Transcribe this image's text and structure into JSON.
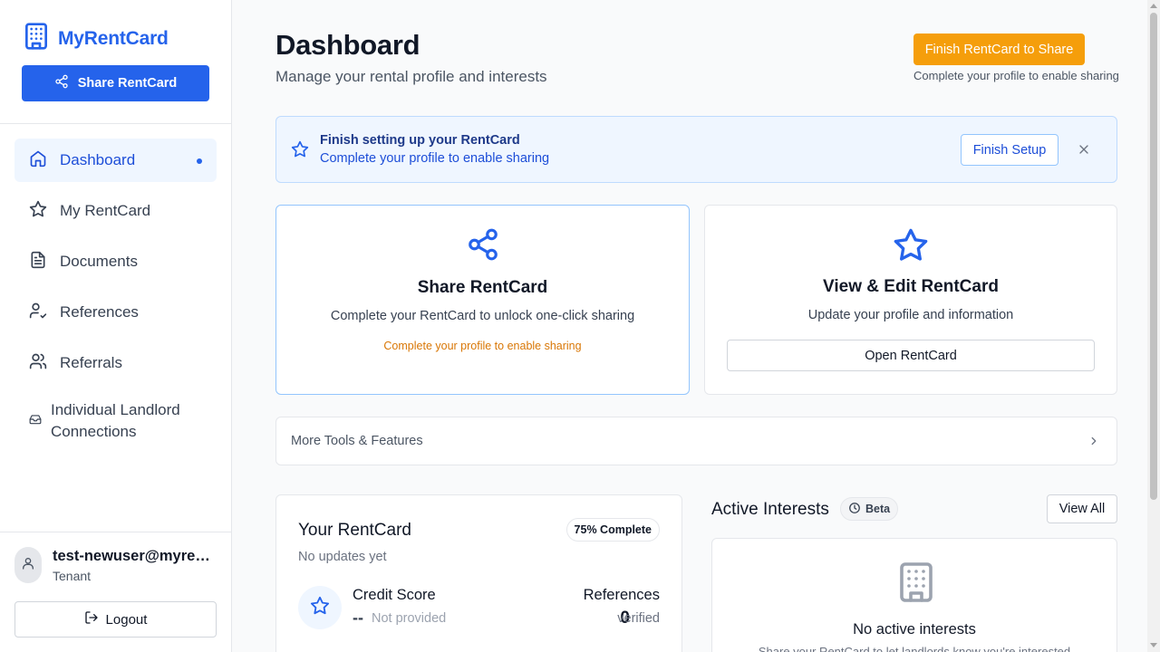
{
  "brand": {
    "name": "MyRentCard"
  },
  "sidebar": {
    "share_button": "Share RentCard",
    "items": [
      {
        "label": "Dashboard",
        "icon": "home-icon",
        "active": true
      },
      {
        "label": "My RentCard",
        "icon": "star-icon"
      },
      {
        "label": "Documents",
        "icon": "document-icon"
      },
      {
        "label": "References",
        "icon": "user-check-icon"
      },
      {
        "label": "Referrals",
        "icon": "users-icon"
      },
      {
        "label": "Individual Landlord Connections",
        "icon": "inbox-icon"
      }
    ],
    "user": {
      "email": "test-newuser@myrentcard.com",
      "role": "Tenant"
    },
    "logout": "Logout"
  },
  "header": {
    "title": "Dashboard",
    "subtitle": "Manage your rental profile and interests",
    "finish_button": "Finish RentCard to Share",
    "finish_hint": "Complete your profile to enable sharing"
  },
  "banner": {
    "title": "Finish setting up your RentCard",
    "text": "Complete your profile to enable sharing",
    "button": "Finish Setup"
  },
  "share_card": {
    "title": "Share RentCard",
    "description": "Complete your RentCard to unlock one-click sharing",
    "warning": "Complete your profile to enable sharing"
  },
  "view_card": {
    "title": "View & Edit RentCard",
    "description": "Update your profile and information",
    "button": "Open RentCard"
  },
  "more_tools": {
    "label": "More Tools & Features"
  },
  "rentcard": {
    "title": "Your RentCard",
    "badge": "75% Complete",
    "subtitle": "No updates yet",
    "credit_label": "Credit Score",
    "credit_value": "--",
    "credit_note": "Not provided",
    "references_label": "References",
    "references_value": "0",
    "references_note": "verified"
  },
  "active_interests": {
    "title": "Active Interests",
    "beta": "Beta",
    "view_all": "View All",
    "empty_title": "No active interests",
    "empty_hint": "Share your RentCard to let landlords know you're interested"
  },
  "colors": {
    "primary": "#2563eb",
    "accent": "#f59e0b",
    "banner_bg": "#eff6ff",
    "warning_text": "#d97706"
  }
}
